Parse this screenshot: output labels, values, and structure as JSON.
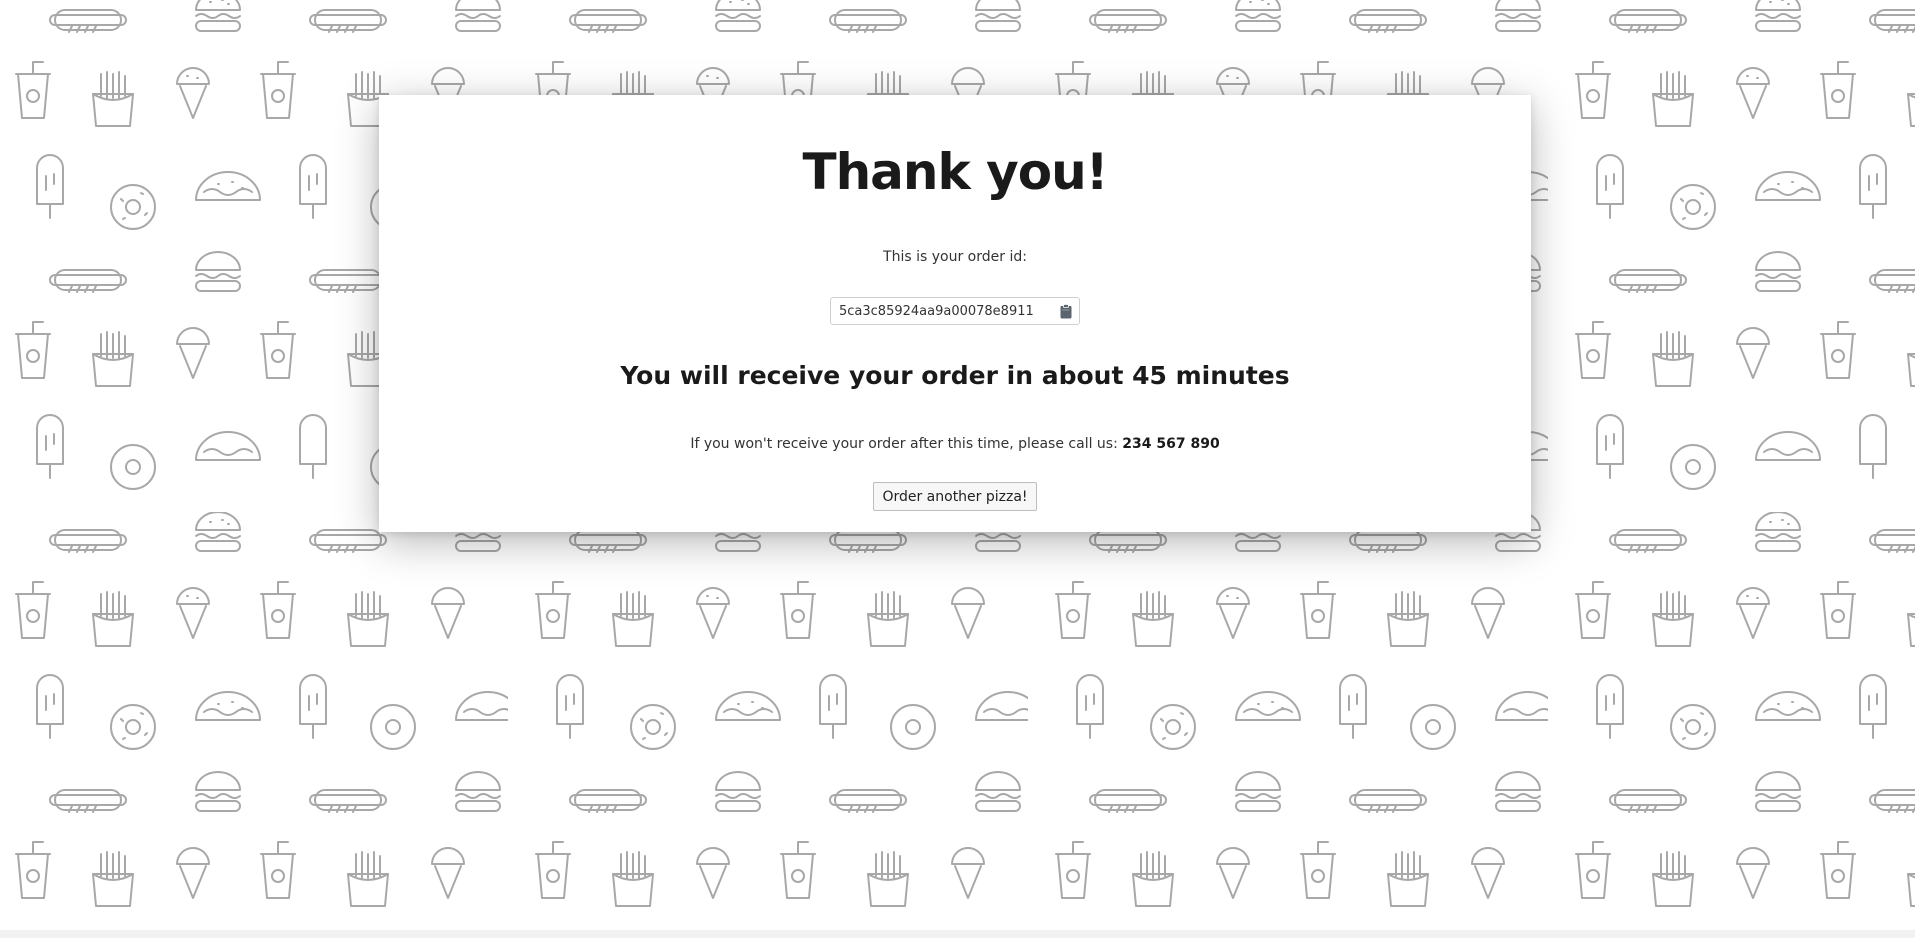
{
  "thank_you": {
    "title": "Thank you!",
    "order_label": "This is your order id:",
    "order_id": "5ca3c85924aa9a00078e8911",
    "delivery_message": "You will receive your order in about 45 minutes",
    "call_text": "If you won't receive your order after this time, please call us:",
    "phone": "234 567 890",
    "order_again_label": "Order another pizza!"
  },
  "icons": {
    "copy": "clipboard-icon",
    "background": [
      "hotdog-icon",
      "burger-icon",
      "soda-cup-icon",
      "fries-icon",
      "ice-cream-icon",
      "donut-icon",
      "taco-icon",
      "popsicle-icon"
    ]
  },
  "colors": {
    "pattern_stroke": "#a8a8a8",
    "card_background": "#ffffff",
    "text": "#1a1a1a"
  }
}
